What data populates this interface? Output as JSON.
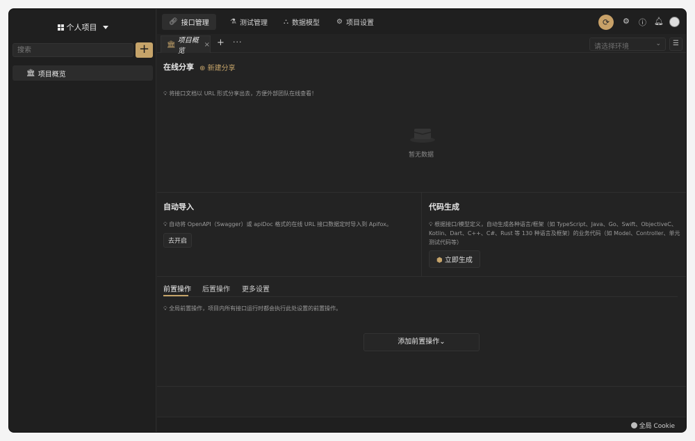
{
  "sidebar": {
    "project_switch": "个人项目",
    "search_placeholder": "搜索",
    "add_label": "+",
    "items": [
      {
        "label": "项目概览"
      }
    ]
  },
  "header": {
    "tabs": [
      {
        "label": "接口管理"
      },
      {
        "label": "测试管理"
      },
      {
        "label": "数据模型"
      },
      {
        "label": "项目设置"
      }
    ]
  },
  "doc_tabs": {
    "active_label": "项目概览",
    "close": "×",
    "plus": "+",
    "more": "···",
    "env_placeholder": "请选择环境"
  },
  "online_share": {
    "title": "在线分享",
    "new_share": "新建分享",
    "hint": "将接口文档以 URL 形式分享出去，方便外部团队在线查看！",
    "empty": "暂无数据"
  },
  "auto_import": {
    "title": "自动导入",
    "hint": "自动将 OpenAPI（Swagger）或 apiDoc 格式的在线 URL 接口数据定时导入到 Apifox。",
    "button": "去开启"
  },
  "code_gen": {
    "title": "代码生成",
    "hint": "根据接口/模型定义，自动生成各种语言/框架（如 TypeScript、Java、Go、Swift、ObjectiveC、Kotlin、Dart、C++、C#、Rust 等 130 种语言及框架）的业务代码（如 Model、Controller、单元测试代码等）",
    "button": "立即生成"
  },
  "pre_ops": {
    "tabs": [
      {
        "label": "前置操作"
      },
      {
        "label": "后置操作"
      },
      {
        "label": "更多设置"
      }
    ],
    "hint": "全局前置操作，项目内所有接口运行时都会执行此处设置的前置操作。",
    "add_button": "添加前置操作"
  },
  "footer": {
    "cookie": "全局 Cookie"
  },
  "colors": {
    "accent": "#c6a46a",
    "background": "#232323"
  }
}
